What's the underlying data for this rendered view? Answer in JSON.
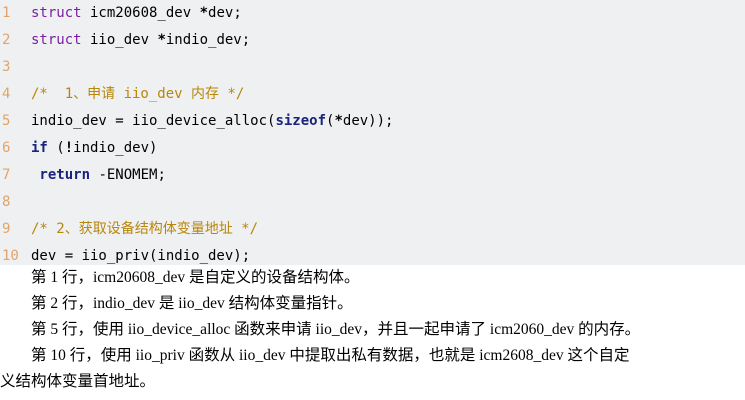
{
  "code_lines": [
    {
      "num": "1",
      "segments": [
        {
          "text": "struct",
          "style": "kw-purple"
        },
        {
          "text": " icm20608_dev ",
          "style": "plain"
        },
        {
          "text": "*",
          "style": "bold"
        },
        {
          "text": "dev;",
          "style": "plain"
        }
      ]
    },
    {
      "num": "2",
      "segments": [
        {
          "text": "struct",
          "style": "kw-purple"
        },
        {
          "text": " iio_dev ",
          "style": "plain"
        },
        {
          "text": "*",
          "style": "bold"
        },
        {
          "text": "indio_dev;",
          "style": "plain"
        }
      ]
    },
    {
      "num": "3",
      "segments": []
    },
    {
      "num": "4",
      "segments": [
        {
          "text": "/*  1、申请 iio_dev 内存 */",
          "style": "comment"
        }
      ]
    },
    {
      "num": "5",
      "segments": [
        {
          "text": "indio_dev = iio_device_alloc(",
          "style": "plain"
        },
        {
          "text": "sizeof",
          "style": "kw-navy"
        },
        {
          "text": "(",
          "style": "plain"
        },
        {
          "text": "*",
          "style": "bold"
        },
        {
          "text": "dev));",
          "style": "plain"
        }
      ]
    },
    {
      "num": "6",
      "segments": [
        {
          "text": "if",
          "style": "kw-navy"
        },
        {
          "text": " (",
          "style": "plain"
        },
        {
          "text": "!",
          "style": "bold"
        },
        {
          "text": "indio_dev)",
          "style": "plain"
        }
      ]
    },
    {
      "num": "7",
      "segments": [
        {
          "text": " return",
          "style": "kw-navy"
        },
        {
          "text": " -ENOMEM;",
          "style": "plain"
        }
      ]
    },
    {
      "num": "8",
      "segments": []
    },
    {
      "num": "9",
      "segments": [
        {
          "text": "/* 2、获取设备结构体变量地址 */",
          "style": "comment"
        }
      ]
    },
    {
      "num": "10",
      "segments": [
        {
          "text": "dev = iio_priv(indio_dev);",
          "style": "plain"
        }
      ]
    }
  ],
  "paragraphs": [
    "　　第 1 行，icm20608_dev 是自定义的设备结构体。",
    "　　第 2 行，indio_dev 是 iio_dev 结构体变量指针。",
    "　　第 5 行，使用 iio_device_alloc 函数来申请 iio_dev，并且一起申请了 icm2060_dev 的内存。",
    "　　第 10 行，使用 iio_priv 函数从 iio_dev 中提取出私有数据，也就是 icm2608_dev 这个自定",
    "义结构体变量首地址。"
  ]
}
